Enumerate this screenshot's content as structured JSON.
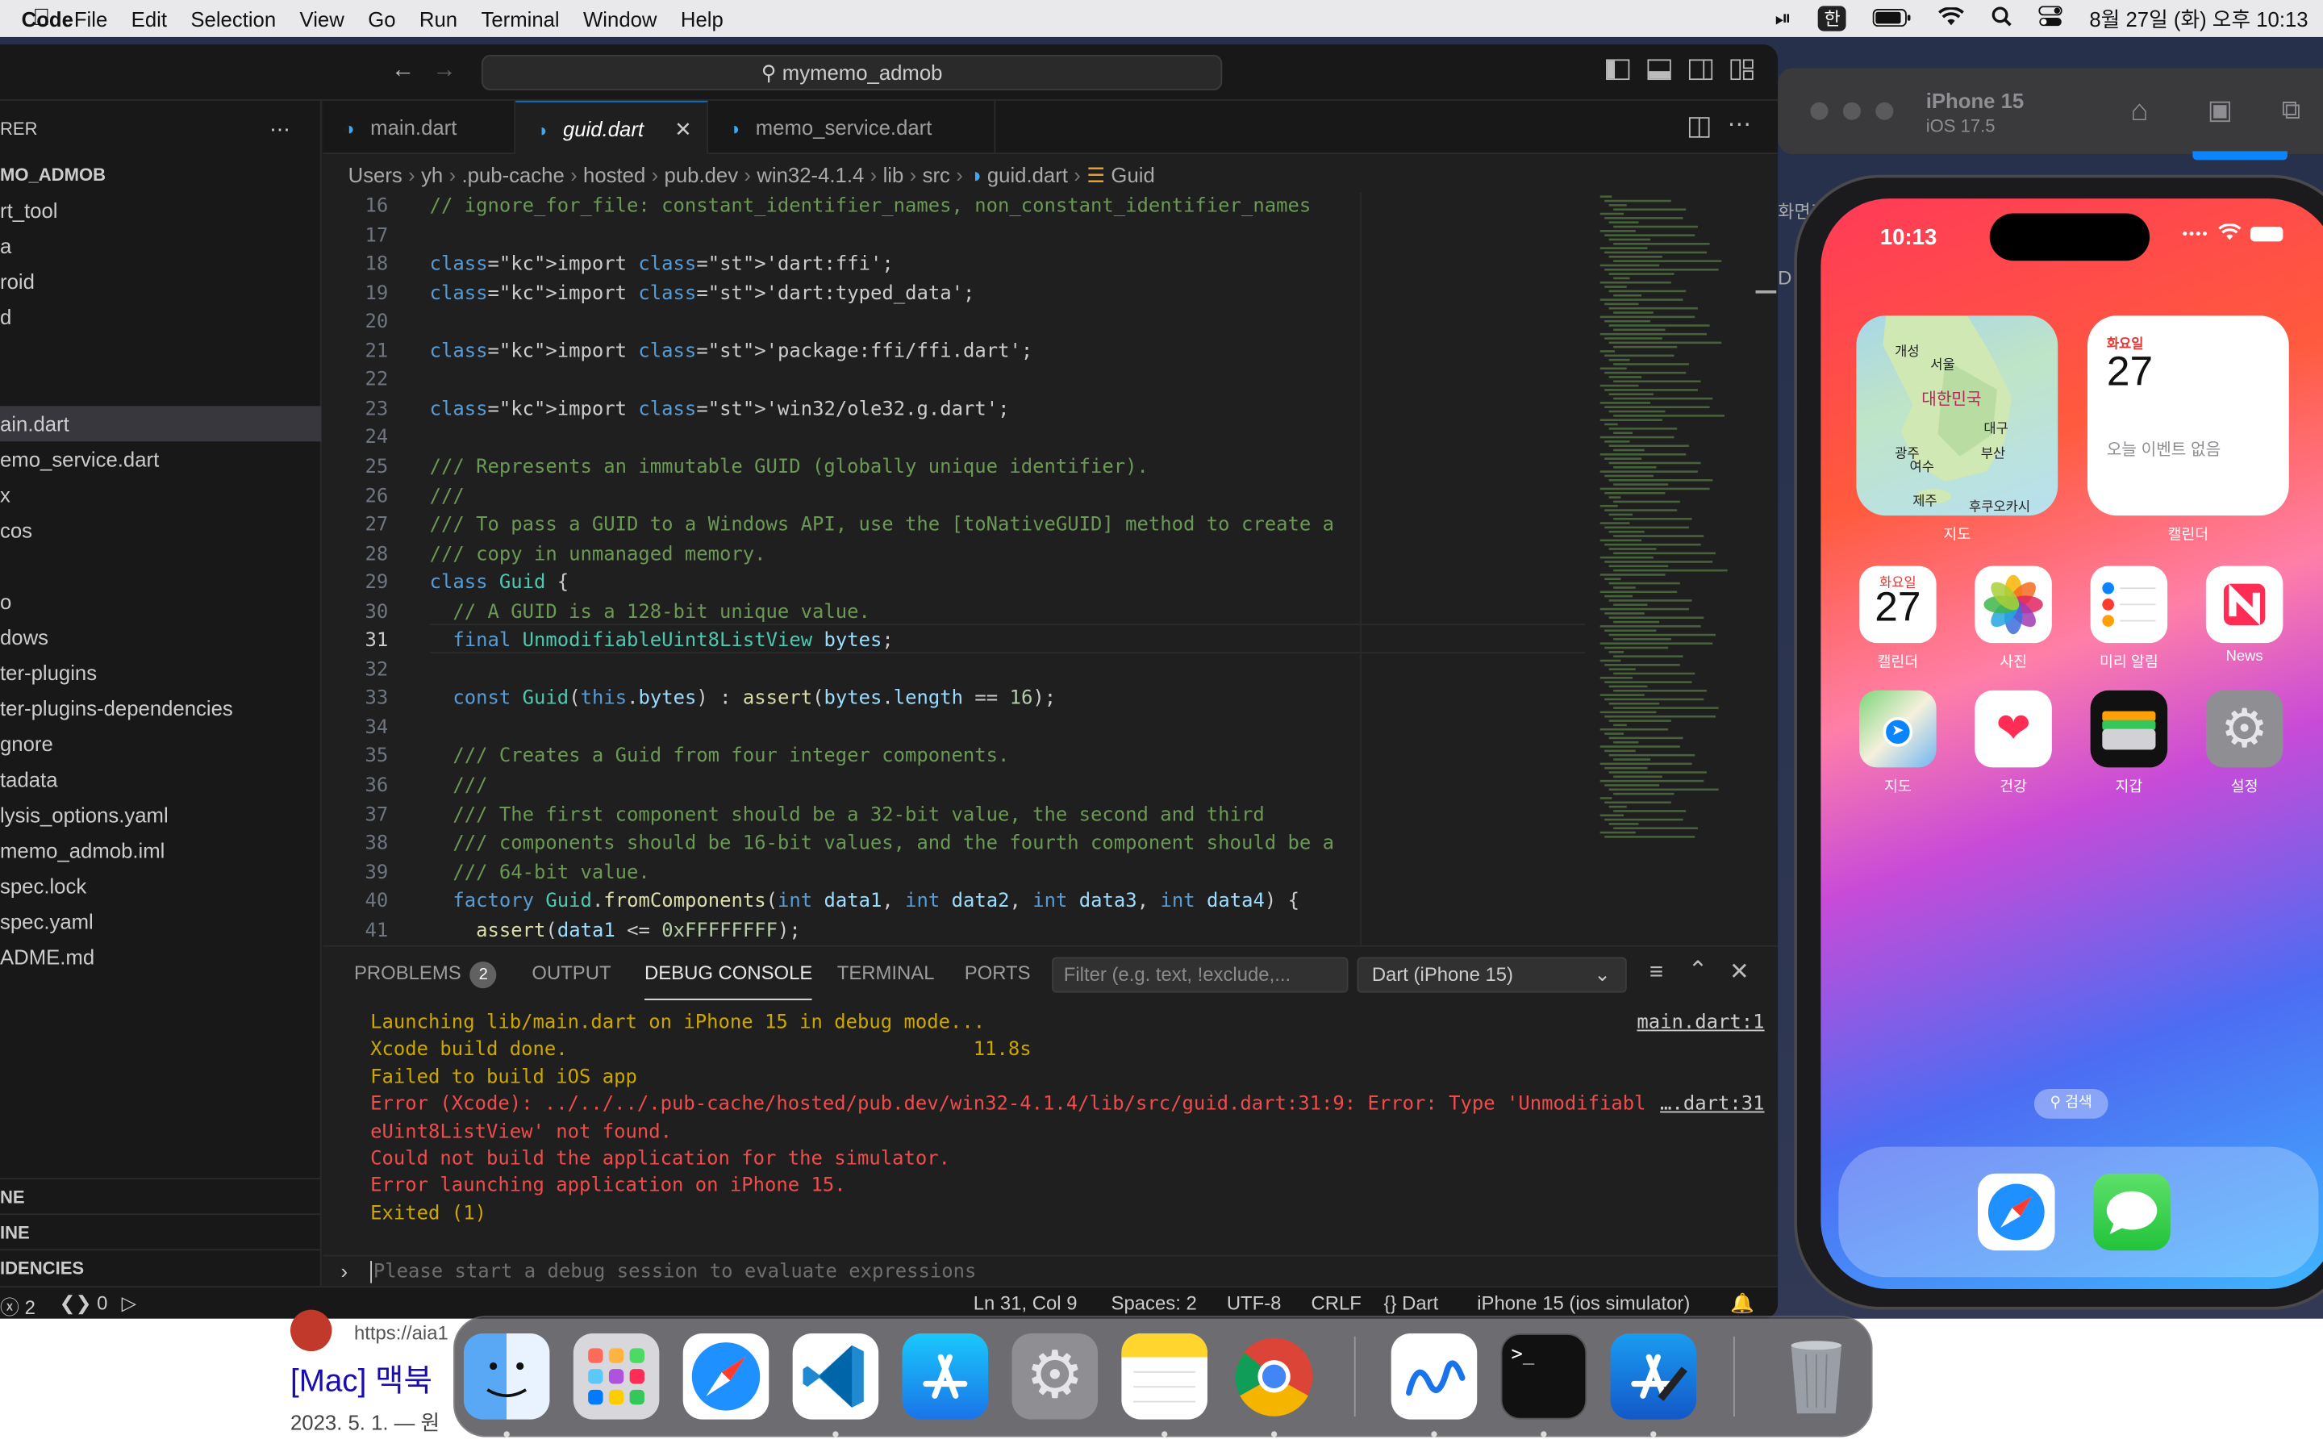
{
  "menubar": {
    "app": "Code",
    "items": [
      "File",
      "Edit",
      "Selection",
      "View",
      "Go",
      "Run",
      "Terminal",
      "Window",
      "Help"
    ],
    "ime": "한",
    "datetime": "8월 27일 (화) 오후 10:13"
  },
  "window": {
    "search": "mymemo_admob"
  },
  "explorer": {
    "title": "RER",
    "project": "MO_ADMOB",
    "items": [
      "rt_tool",
      "a",
      "roid",
      "d",
      "",
      "",
      "ain.dart",
      "emo_service.dart",
      "x",
      "cos",
      "",
      "o",
      "dows",
      "ter-plugins",
      "ter-plugins-dependencies",
      "gnore",
      "tadata",
      "lysis_options.yaml",
      "memo_admob.iml",
      "spec.lock",
      "spec.yaml",
      "ADME.md"
    ],
    "sections": [
      "NE",
      "INE",
      "IDENCIES"
    ]
  },
  "tabs": [
    "main.dart",
    "guid.dart",
    "memo_service.dart"
  ],
  "breadcrumb": [
    "Users",
    "yh",
    ".pub-cache",
    "hosted",
    "pub.dev",
    "win32-4.1.4",
    "lib",
    "src",
    "guid.dart",
    "Guid"
  ],
  "editor": {
    "line_numbers": [
      "16",
      "17",
      "18",
      "19",
      "20",
      "21",
      "22",
      "23",
      "24",
      "25",
      "26",
      "27",
      "28",
      "29",
      "30",
      "31",
      "32",
      "33",
      "34",
      "35",
      "36",
      "37",
      "38",
      "39",
      "40",
      "41"
    ],
    "lines": [
      "// ignore_for_file: constant_identifier_names, non_constant_identifier_names",
      "",
      "import 'dart:ffi';",
      "import 'dart:typed_data';",
      "",
      "import 'package:ffi/ffi.dart';",
      "",
      "import 'win32/ole32.g.dart';",
      "",
      "/// Represents an immutable GUID (globally unique identifier).",
      "///",
      "/// To pass a GUID to a Windows API, use the [toNativeGUID] method to create a",
      "/// copy in unmanaged memory.",
      "class Guid {",
      "  // A GUID is a 128-bit unique value.",
      "  final UnmodifiableUint8ListView bytes;",
      "",
      "  const Guid(this.bytes) : assert(bytes.length == 16);",
      "",
      "  /// Creates a Guid from four integer components.",
      "  ///",
      "  /// The first component should be a 32-bit value, the second and third",
      "  /// components should be 16-bit values, and the fourth component should be a",
      "  /// 64-bit value.",
      "  factory Guid.fromComponents(int data1, int data2, int data3, int data4) {",
      "    assert(data1 <= 0xFFFFFFFF);"
    ]
  },
  "panel": {
    "tabs": [
      "PROBLEMS",
      "OUTPUT",
      "DEBUG CONSOLE",
      "TERMINAL",
      "PORTS"
    ],
    "problems_count": "2",
    "filter_placeholder": "Filter (e.g. text, !exclude,...",
    "session": "Dart (iPhone 15)",
    "console": [
      {
        "text": "Launching lib/main.dart on iPhone 15 in debug mode...",
        "link": "main.dart:1",
        "type": "warn"
      },
      {
        "text": "Xcode build done.                                   11.8s",
        "link": "",
        "type": "warn"
      },
      {
        "text": "Failed to build iOS app",
        "link": "",
        "type": "warn"
      },
      {
        "text": "Error (Xcode): ../../../.pub-cache/hosted/pub.dev/win32-4.1.4/lib/src/guid.dart:31:9: Error: Type 'Unmodifiabl",
        "link": "….dart:31",
        "type": "err"
      },
      {
        "text": "eUint8ListView' not found.",
        "link": "",
        "type": "err"
      },
      {
        "text": "Could not build the application for the simulator.",
        "link": "",
        "type": "err"
      },
      {
        "text": "Error launching application on iPhone 15.",
        "link": "",
        "type": "err"
      },
      {
        "text": "Exited (1)",
        "link": "",
        "type": "warn"
      }
    ],
    "eval_placeholder": "Please start a debug session to evaluate expressions"
  },
  "status": {
    "errors": "2",
    "ports": "0",
    "position": "Ln 31, Col 9",
    "spaces": "Spaces: 2",
    "encoding": "UTF-8",
    "eol": "CRLF",
    "language": "Dart",
    "device": "iPhone 15 (ios simulator)"
  },
  "simulator": {
    "device": "iPhone 15",
    "os": "iOS 17.5",
    "side_text": "화면키",
    "side_letter": "D"
  },
  "phone": {
    "time": "10:13",
    "map_widget": {
      "label": "지도",
      "places": [
        "개성",
        "서울",
        "대한민국",
        "대구",
        "광주",
        "부산",
        "여수",
        "제주",
        "후쿠오카시"
      ]
    },
    "calendar_widget": {
      "label": "캘린더",
      "weekday": "화요일",
      "day": "27",
      "event": "오늘 이벤트 없음"
    },
    "apps": [
      {
        "label": "캘린더",
        "weekday": "화요일",
        "day": "27"
      },
      {
        "label": "사진"
      },
      {
        "label": "미리 알림"
      },
      {
        "label": "News"
      },
      {
        "label": "지도"
      },
      {
        "label": "건강"
      },
      {
        "label": "지갑"
      },
      {
        "label": "설정"
      }
    ],
    "search": "검색"
  },
  "web": {
    "url": "https://aia1",
    "heading": "[Mac] 맥북",
    "date": "2023. 5. 1. — 원"
  },
  "colors": {
    "accent": "#0078d4",
    "error": "#f14c4c",
    "warning": "#cca700",
    "editor_bg": "#1f1f1f"
  }
}
